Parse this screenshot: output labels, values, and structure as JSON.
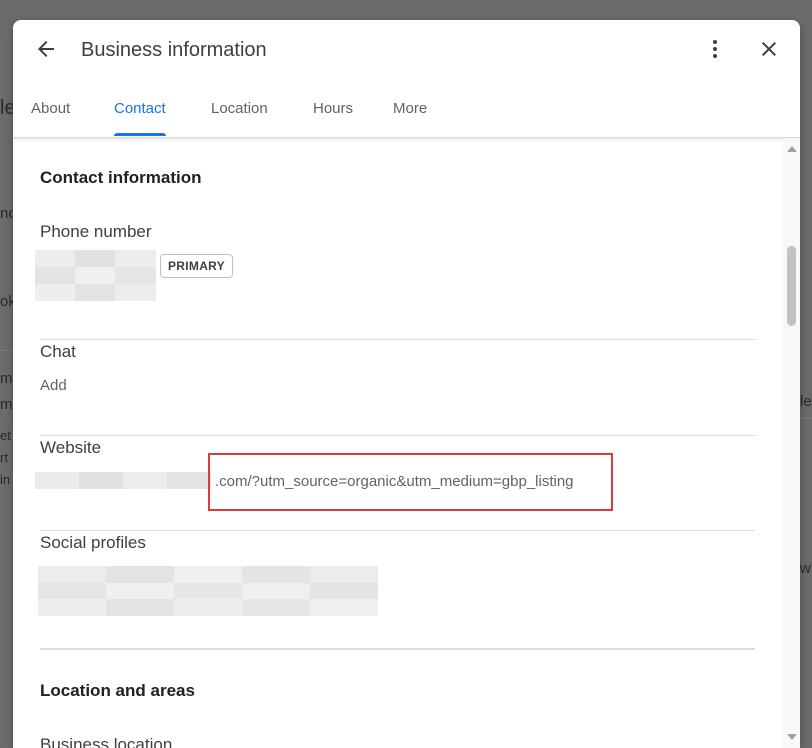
{
  "dialog": {
    "title": "Business information",
    "tabs": [
      {
        "label": "About",
        "active": false
      },
      {
        "label": "Contact",
        "active": true
      },
      {
        "label": "Location",
        "active": false
      },
      {
        "label": "Hours",
        "active": false
      },
      {
        "label": "More",
        "active": false
      }
    ]
  },
  "contact": {
    "section_title": "Contact information",
    "phone_label": "Phone number",
    "phone_badge": "PRIMARY",
    "chat_label": "Chat",
    "chat_value": "Add",
    "website_label": "Website",
    "website_value": ".com/?utm_source=organic&utm_medium=gbp_listing",
    "social_label": "Social profiles"
  },
  "location": {
    "section_title": "Location and areas",
    "business_location_label": "Business location"
  },
  "colors": {
    "accent": "#1a73e8",
    "highlight": "#e0393b"
  }
}
